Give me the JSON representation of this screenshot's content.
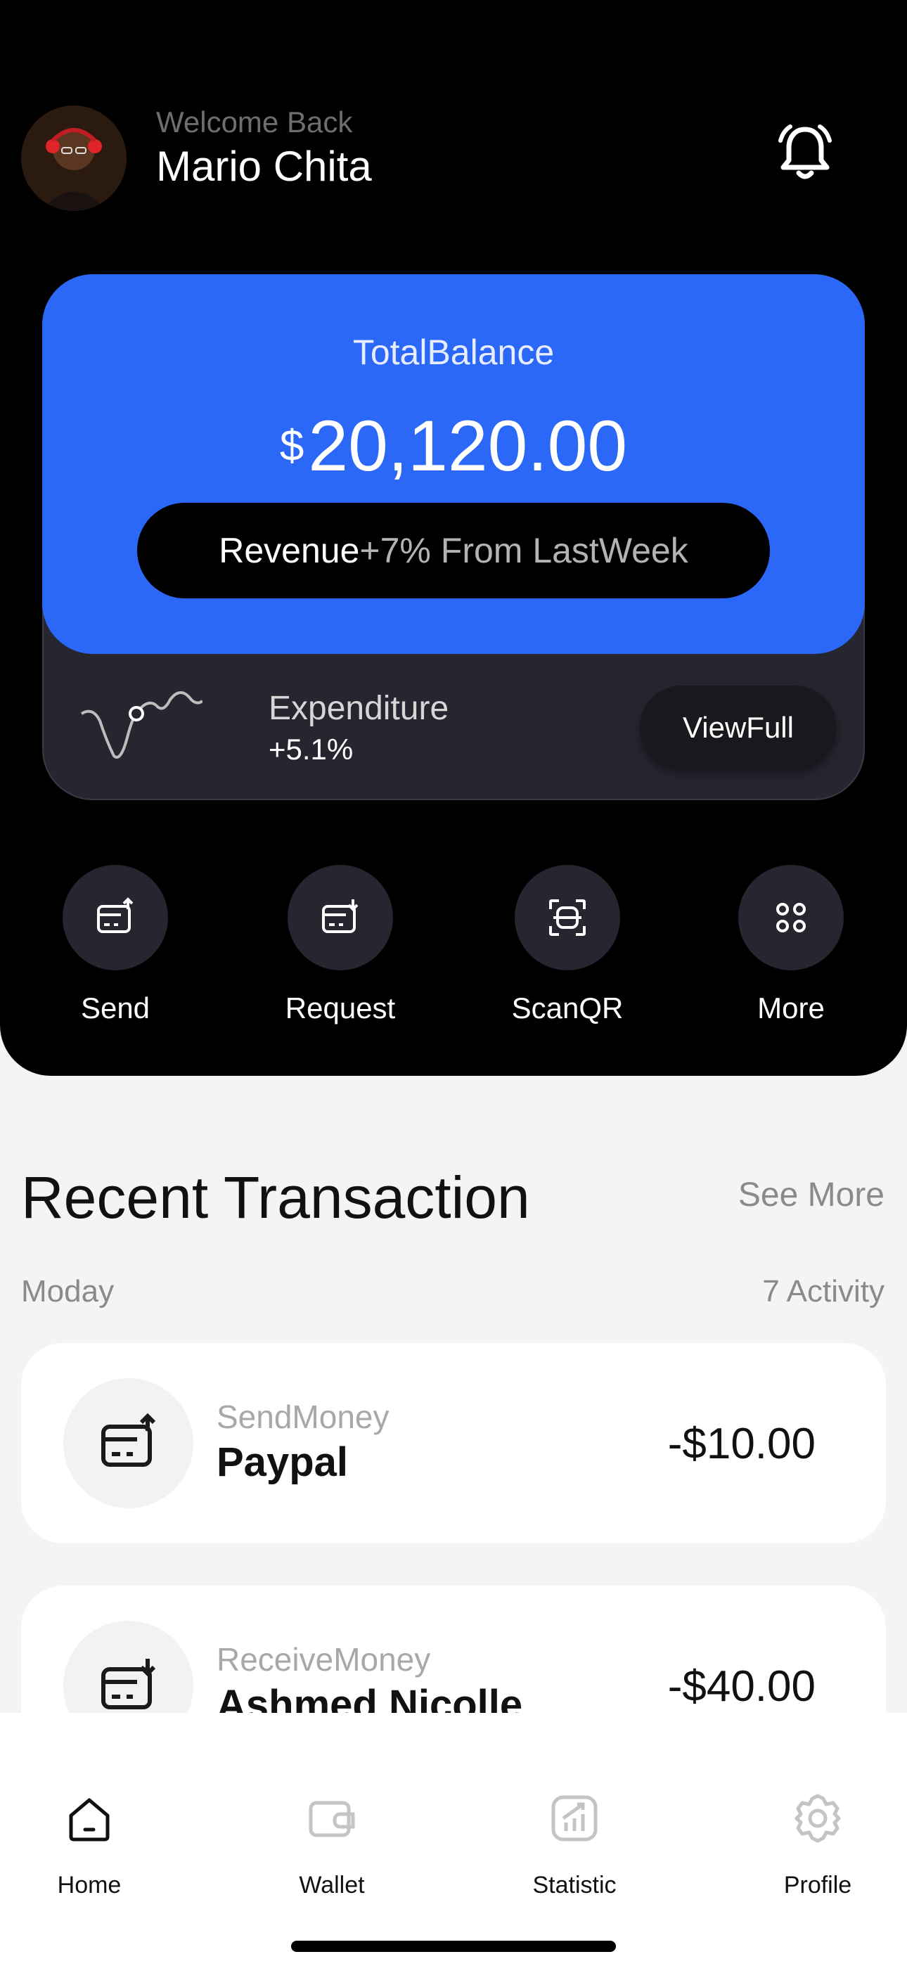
{
  "header": {
    "welcome": "Welcome Back",
    "username": "Mario Chita",
    "icons": {
      "avatar": "user-avatar",
      "notifications": "bell-icon"
    }
  },
  "balance": {
    "label": "TotalBalance",
    "currency": "$",
    "amount": "20,120.00",
    "revenue_label": "Revenue",
    "revenue_change": "+7% From LastWeek",
    "accent_color": "#2c68f8"
  },
  "expenditure": {
    "label": "Expenditure",
    "value": "+5.1%",
    "button": "ViewFull"
  },
  "actions": [
    {
      "label": "Send",
      "icon": "card-send-icon"
    },
    {
      "label": "Request",
      "icon": "card-request-icon"
    },
    {
      "label": "ScanQR",
      "icon": "scan-qr-icon"
    },
    {
      "label": "More",
      "icon": "grid-dots-icon"
    }
  ],
  "transactions": {
    "title": "Recent Transaction",
    "see_more": "See More",
    "day": "Moday",
    "activity_count": "7 Activity",
    "items": [
      {
        "type": "SendMoney",
        "name": "Paypal",
        "amount": "-$10.00",
        "icon": "card-send-icon"
      },
      {
        "type": "ReceiveMoney",
        "name": "Ashmed Nicolle",
        "amount": "-$40.00",
        "icon": "card-receive-icon"
      }
    ]
  },
  "nav": [
    {
      "label": "Home",
      "icon": "home-icon",
      "active": true
    },
    {
      "label": "Wallet",
      "icon": "wallet-icon",
      "active": false
    },
    {
      "label": "Statistic",
      "icon": "chart-icon",
      "active": false
    },
    {
      "label": "Profile",
      "icon": "gear-icon",
      "active": false
    }
  ]
}
